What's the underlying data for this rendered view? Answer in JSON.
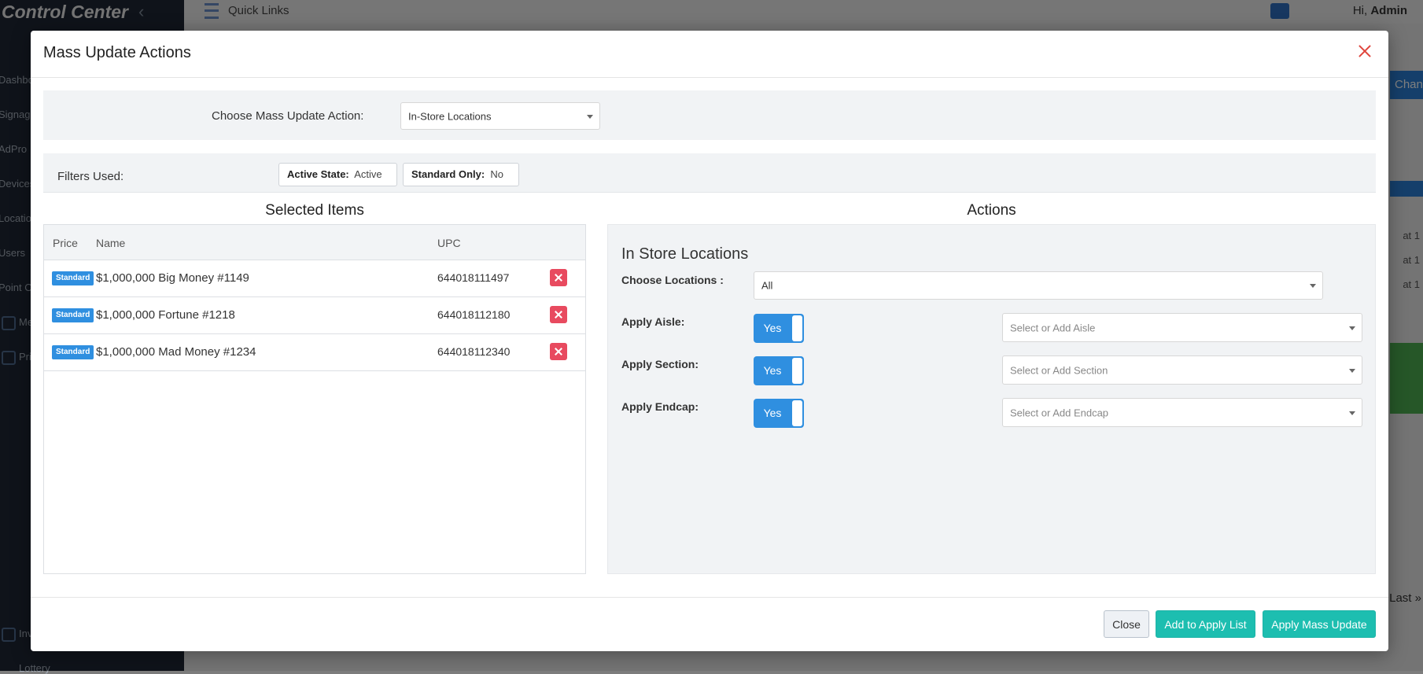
{
  "app": {
    "brand": "Control Center",
    "topbar": {
      "quick_links": "Quick Links",
      "greeting": "Hi,",
      "user": "Admin"
    },
    "sidebar_items": [
      "Dashboard",
      "Signage",
      "AdPro",
      "Devices",
      "Locations",
      "Users",
      "Point O",
      "Me",
      "Pri",
      "Inv",
      "Lottery"
    ],
    "background_right": {
      "change_button": "Change",
      "row_texts": [
        "at 1",
        "at 1",
        "at 1"
      ],
      "pager_last": "Last »"
    }
  },
  "modal": {
    "title": "Mass Update Actions",
    "choose_action_label": "Choose Mass Update Action:",
    "choose_action_value": "In-Store Locations",
    "filters": {
      "label": "Filters Used:",
      "chips": [
        {
          "key": "Active State:",
          "value": "Active"
        },
        {
          "key": "Standard Only:",
          "value": "No"
        }
      ]
    },
    "selected_items": {
      "heading": "Selected Items",
      "columns": {
        "price": "Price",
        "name": "Name",
        "upc": "UPC"
      },
      "rows": [
        {
          "badge": "Standard",
          "name": "$1,000,000 Big Money #1149",
          "upc": "644018111497"
        },
        {
          "badge": "Standard",
          "name": "$1,000,000 Fortune #1218",
          "upc": "644018112180"
        },
        {
          "badge": "Standard",
          "name": "$1,000,000 Mad Money #1234",
          "upc": "644018112340"
        }
      ]
    },
    "actions": {
      "heading": "Actions",
      "subtitle": "In Store Locations",
      "choose_locations_label": "Choose Locations :",
      "choose_locations_value": "All",
      "fields": [
        {
          "label": "Apply Aisle:",
          "toggle": "Yes",
          "placeholder": "Select or Add Aisle"
        },
        {
          "label": "Apply Section:",
          "toggle": "Yes",
          "placeholder": "Select or Add Section"
        },
        {
          "label": "Apply Endcap:",
          "toggle": "Yes",
          "placeholder": "Select or Add Endcap"
        }
      ]
    },
    "footer": {
      "close": "Close",
      "add_to_apply_list": "Add to Apply List",
      "apply_mass_update": "Apply Mass Update"
    }
  }
}
